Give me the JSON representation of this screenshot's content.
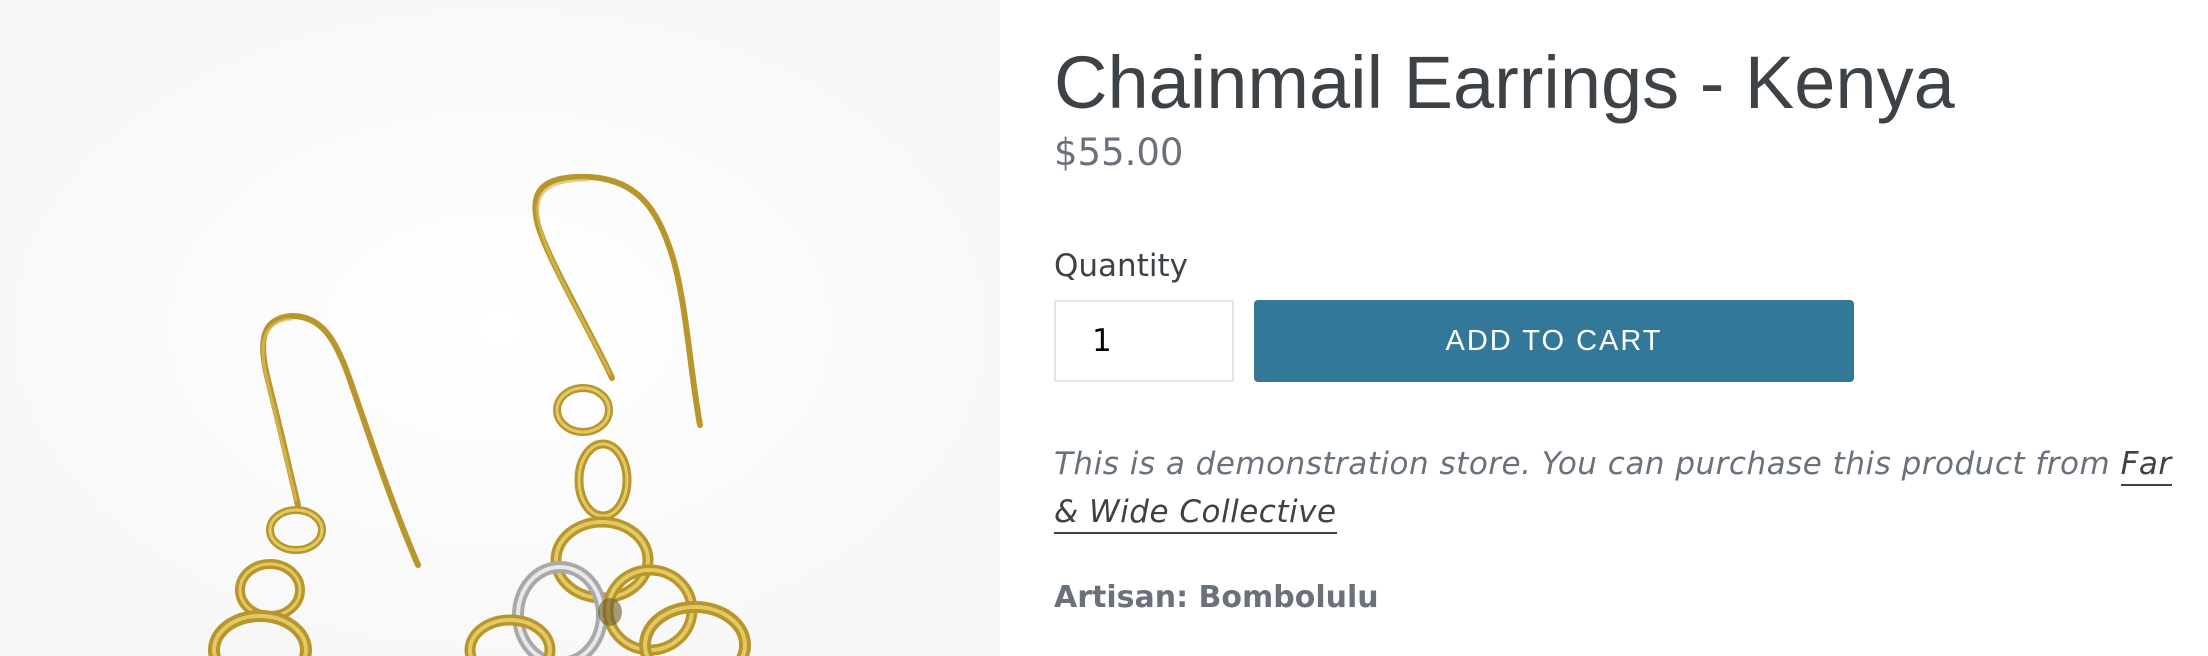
{
  "product": {
    "title": "Chainmail Earrings - Kenya",
    "price": "$55.00",
    "image_icon": "earrings-product-image"
  },
  "form": {
    "quantity_label": "Quantity",
    "quantity_value": "1",
    "add_to_cart_label": "ADD TO CART"
  },
  "description": {
    "note_text": "This is a demonstration store. You can purchase this product from ",
    "link_text": "Far & Wide Collective",
    "artisan": "Artisan: Bombolulu"
  },
  "colors": {
    "accent": "#337899",
    "title": "#3d4246",
    "muted": "#69727b",
    "gold": "#c9a93a",
    "silver": "#c9c9c9"
  }
}
